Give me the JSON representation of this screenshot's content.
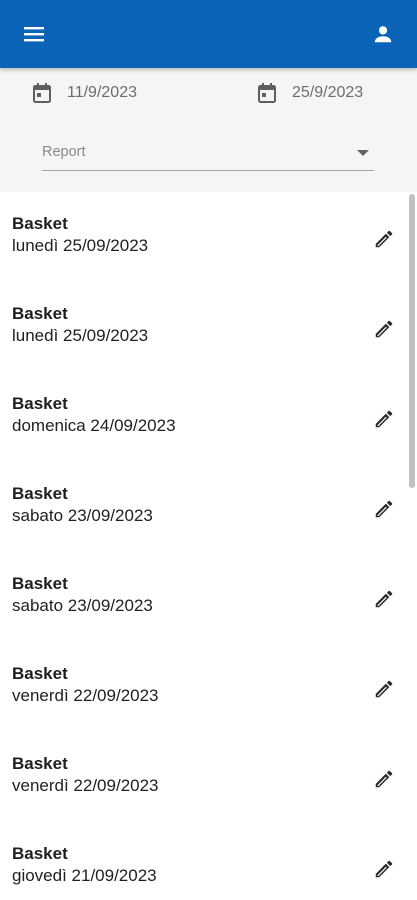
{
  "app_bar": {
    "menu_icon": "menu-icon",
    "account_icon": "account-icon",
    "color": "#0a63b6"
  },
  "filters": {
    "start_date": "11/9/2023",
    "end_date": "25/9/2023",
    "report_select": {
      "label": "Report"
    }
  },
  "items": [
    {
      "title": "Basket",
      "subtitle": "lunedì 25/09/2023"
    },
    {
      "title": "Basket",
      "subtitle": "lunedì 25/09/2023"
    },
    {
      "title": "Basket",
      "subtitle": "domenica 24/09/2023"
    },
    {
      "title": "Basket",
      "subtitle": "sabato 23/09/2023"
    },
    {
      "title": "Basket",
      "subtitle": "sabato 23/09/2023"
    },
    {
      "title": "Basket",
      "subtitle": "venerdì 22/09/2023"
    },
    {
      "title": "Basket",
      "subtitle": "venerdì 22/09/2023"
    },
    {
      "title": "Basket",
      "subtitle": "giovedì 21/09/2023"
    }
  ]
}
